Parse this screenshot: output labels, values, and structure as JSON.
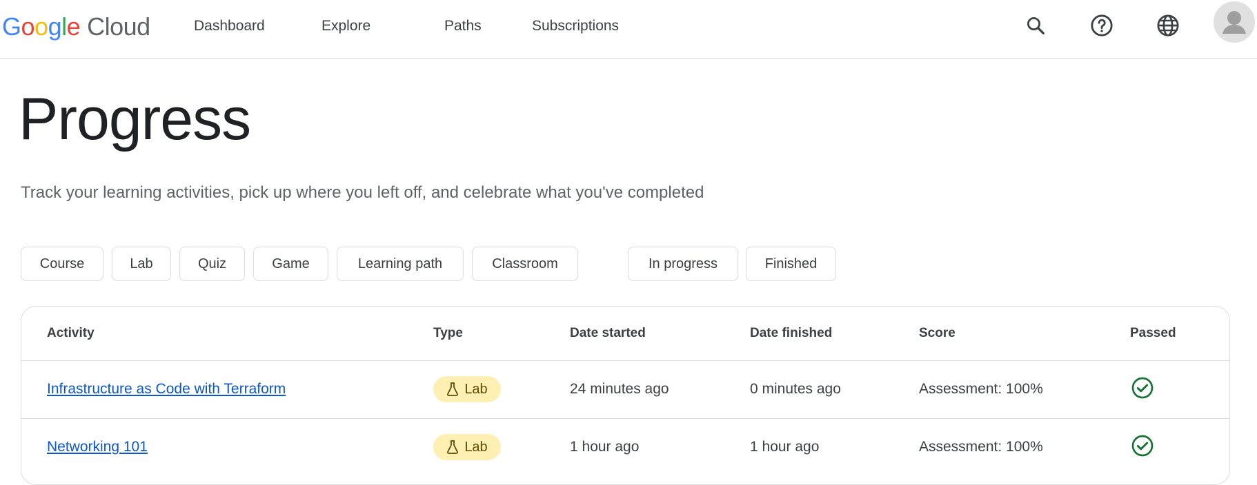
{
  "header": {
    "logo": {
      "google_letters": [
        {
          "ch": "G",
          "color": "#4285F4"
        },
        {
          "ch": "o",
          "color": "#EA4335"
        },
        {
          "ch": "o",
          "color": "#FBBC05"
        },
        {
          "ch": "g",
          "color": "#4285F4"
        },
        {
          "ch": "l",
          "color": "#34A853"
        },
        {
          "ch": "e",
          "color": "#EA4335"
        }
      ],
      "google_text": "Google",
      "cloud_text": "Cloud"
    },
    "nav": [
      "Dashboard",
      "Explore",
      "Paths",
      "Subscriptions"
    ],
    "icons": [
      "search-icon",
      "help-icon",
      "language-icon"
    ],
    "avatar": "avatar"
  },
  "main": {
    "title": "Progress",
    "subtitle": "Track your learning activities, pick up where you left off, and celebrate what you've completed",
    "type_filters": [
      "Course",
      "Lab",
      "Quiz",
      "Game",
      "Learning path",
      "Classroom"
    ],
    "status_filters": [
      "In progress",
      "Finished"
    ]
  },
  "table": {
    "columns": [
      "Activity",
      "Type",
      "Date started",
      "Date finished",
      "Score",
      "Passed"
    ],
    "rows": [
      {
        "activity": "Infrastructure as Code with Terraform",
        "type": "Lab",
        "date_started": "24 minutes ago",
        "date_finished": "0 minutes ago",
        "score": "Assessment: 100%",
        "passed": true
      },
      {
        "activity": "Networking 101",
        "type": "Lab",
        "date_started": "1 hour ago",
        "date_finished": "1 hour ago",
        "score": "Assessment: 100%",
        "passed": true
      }
    ]
  },
  "colors": {
    "link": "#0b57d0",
    "badge_bg": "#fef0b3",
    "check": "#137333"
  }
}
